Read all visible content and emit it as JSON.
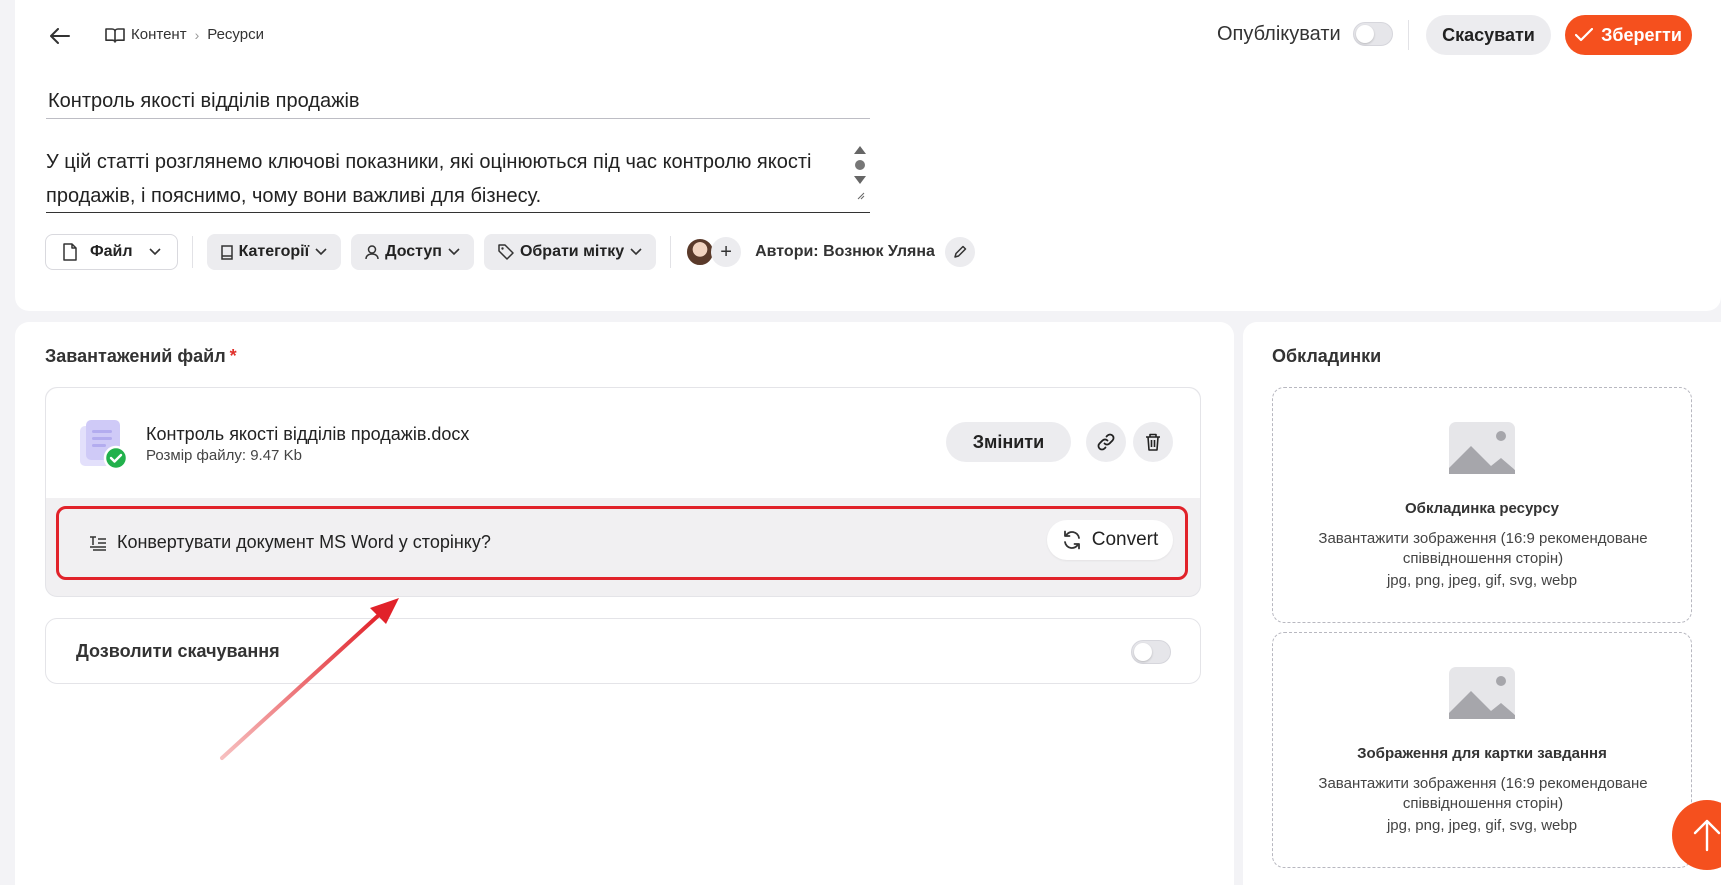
{
  "header": {
    "breadcrumb": [
      "Контент",
      "Ресурси"
    ],
    "publish_label": "Опублікувати",
    "cancel_label": "Скасувати",
    "save_label": "Зберегти"
  },
  "article": {
    "title": "Контроль якості відділів продажів",
    "description": "У цій статті розглянемо ключові показники, які оцінюються під час контролю якості продажів, і пояснимо, чому вони важливі для бізнесу."
  },
  "toolbar": {
    "file_label": "Файл",
    "categories_label": "Категорії",
    "access_label": "Доступ",
    "tag_label": "Обрати мітку",
    "authors_label": "Автори: Вознюк Уляна"
  },
  "upload": {
    "section_label": "Завантажений файл",
    "required_mark": "*",
    "file_name": "Контроль якості відділів продажів.docx",
    "file_size": "Розмір файлу: 9.47 Kb",
    "change_label": "Змінити",
    "convert_question": "Конвертувати документ MS Word у сторінку?",
    "convert_label": "Convert"
  },
  "download": {
    "label": "Дозволити скачування",
    "enabled": false
  },
  "covers": {
    "section_label": "Обкладинки",
    "items": [
      {
        "title": "Обкладинка ресурсу",
        "desc": "Завантажити зображення (16:9 рекомендоване співвідношення сторін)",
        "formats": "jpg, png, jpeg, gif, svg, webp"
      },
      {
        "title": "Зображення для картки завдання",
        "desc": "Завантажити зображення (16:9 рекомендоване співвідношення сторін)",
        "formats": "jpg, png, jpeg, gif, svg, webp"
      }
    ]
  },
  "colors": {
    "accent": "#f5501e",
    "highlight": "#e1222a"
  }
}
